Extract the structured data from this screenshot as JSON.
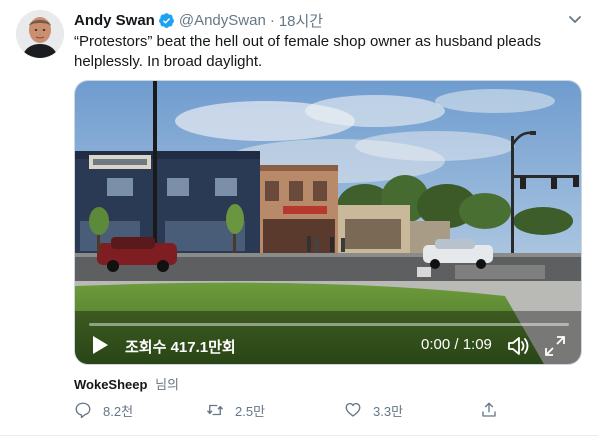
{
  "tweet": {
    "author": {
      "display_name": "Andy Swan",
      "handle": "@AndySwan",
      "verified": true
    },
    "separator": "·",
    "time": "18시간",
    "text": "“Protestors” beat the hell out of female shop owner as husband pleads helplessly.  In broad daylight.",
    "media": {
      "storefront_sign": "ANTIQUE",
      "views": "조회수 417.1만회",
      "timecode": "0:00 / 1:09",
      "progress": 0
    },
    "attribution": {
      "user": "WokeSheep",
      "suffix": "님의"
    },
    "actions": {
      "reply_count": "8.2천",
      "retweet_count": "2.5만",
      "like_count": "3.3만"
    },
    "colors": {
      "verified": "#1da1f2",
      "secondary_text": "#657786",
      "primary_text": "#14171a"
    }
  }
}
